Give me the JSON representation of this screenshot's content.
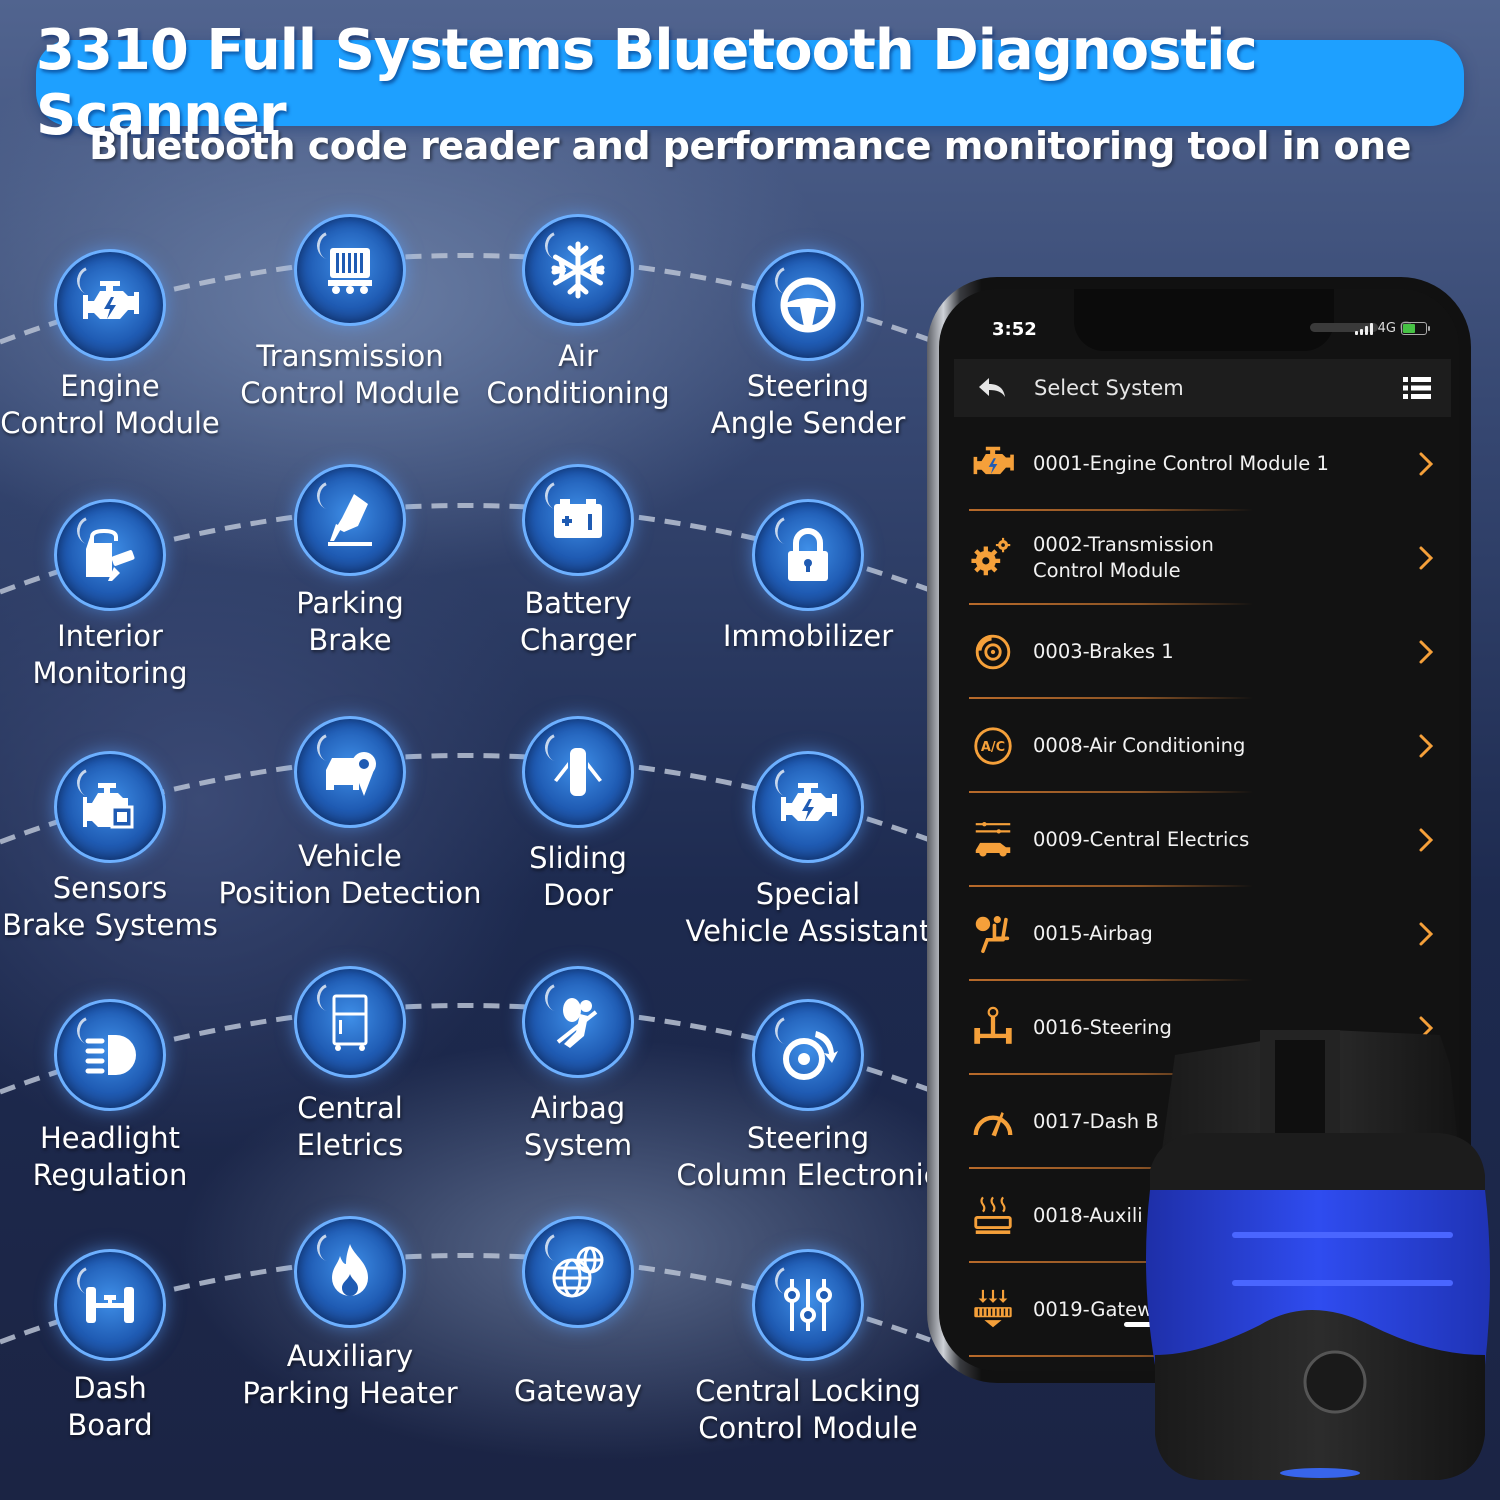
{
  "header": {
    "title": "3310 Full Systems Bluetooth Diagnostic Scanner",
    "subtitle": "Bluetooth code reader and performance monitoring tool in one"
  },
  "features": [
    {
      "label": "Engine\nControl Module",
      "icon": "engine-icon"
    },
    {
      "label": "Transmission\nControl Module",
      "icon": "transmission-icon"
    },
    {
      "label": "Air\nConditioning",
      "icon": "snowflake-icon"
    },
    {
      "label": "Steering\nAngle Sender",
      "icon": "steering-wheel-icon"
    },
    {
      "label": "Interior\nMonitoring",
      "icon": "car-camera-icon"
    },
    {
      "label": "Parking\nBrake",
      "icon": "brake-pedal-icon"
    },
    {
      "label": "Battery\nCharger",
      "icon": "battery-icon"
    },
    {
      "label": "Immobilizer",
      "icon": "padlock-icon"
    },
    {
      "label": "Sensors\nBrake Systems",
      "icon": "engine-chip-icon"
    },
    {
      "label": "Vehicle\nPosition Detection",
      "icon": "car-location-icon"
    },
    {
      "label": "Sliding\nDoor",
      "icon": "car-doors-icon"
    },
    {
      "label": "Special\nVehicle Assistant",
      "icon": "engine-icon"
    },
    {
      "label": "Headlight\nRegulation",
      "icon": "headlight-icon"
    },
    {
      "label": "Central\nEletrics",
      "icon": "cabinet-icon"
    },
    {
      "label": "Airbag\nSystem",
      "icon": "airbag-icon"
    },
    {
      "label": "Steering\nColumn Electronic",
      "icon": "steering-column-icon"
    },
    {
      "label": "Dash\nBoard",
      "icon": "axle-icon"
    },
    {
      "label": "Auxiliary\nParking Heater",
      "icon": "flame-icon"
    },
    {
      "label": "Gateway",
      "icon": "globe-icon"
    },
    {
      "label": "Central Locking\nControl Module",
      "icon": "sliders-icon"
    }
  ],
  "phone": {
    "status_bar": {
      "time": "3:52",
      "network": "4G"
    },
    "nav": {
      "title": "Select System"
    },
    "systems": [
      {
        "label": "0001-Engine Control Module 1",
        "icon": "engine-icon"
      },
      {
        "label": "0002-Transmission\nControl Module",
        "icon": "gears-icon"
      },
      {
        "label": "0003-Brakes 1",
        "icon": "brake-disc-icon"
      },
      {
        "label": "0008-Air Conditioning",
        "icon": "ac-icon"
      },
      {
        "label": "0009-Central Electrics",
        "icon": "car-sliders-icon"
      },
      {
        "label": "0015-Airbag",
        "icon": "airbag-seat-icon"
      },
      {
        "label": "0016-Steering",
        "icon": "steering-axle-icon"
      },
      {
        "label": "0017-Dash B",
        "icon": "gauge-icon"
      },
      {
        "label": "0018-Auxili",
        "icon": "heater-icon"
      },
      {
        "label": "0019-Gatew",
        "icon": "gateway-icon"
      }
    ]
  },
  "colors": {
    "accent_blue": "#1ea0ff",
    "app_orange": "#f5a03a",
    "device_blue": "#2b45d8"
  }
}
